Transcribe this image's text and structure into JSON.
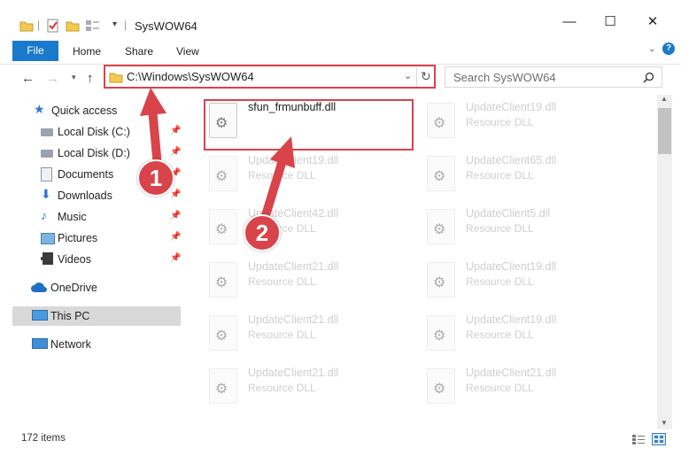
{
  "window": {
    "title": "SysWOW64",
    "minimize_glyph": "—",
    "maximize_glyph": "☐",
    "close_glyph": "✕"
  },
  "ribbon": {
    "file": "File",
    "tabs": [
      "Home",
      "Share",
      "View"
    ]
  },
  "nav": {
    "address": "C:\\Windows\\SysWOW64",
    "search_placeholder": "Search SysWOW64"
  },
  "sidebar": {
    "items": [
      {
        "label": "Quick access",
        "icon": "star-icon"
      },
      {
        "label": "Local Disk (C:)",
        "icon": "drive-icon"
      },
      {
        "label": "Local Disk (D:)",
        "icon": "drive-icon"
      },
      {
        "label": "Documents",
        "icon": "documents-icon"
      },
      {
        "label": "Downloads",
        "icon": "downloads-icon"
      },
      {
        "label": "Music",
        "icon": "music-icon"
      },
      {
        "label": "Pictures",
        "icon": "pictures-icon"
      },
      {
        "label": "Videos",
        "icon": "videos-icon"
      },
      {
        "label": "OneDrive",
        "icon": "cloud-icon"
      },
      {
        "label": "This PC",
        "icon": "computer-icon"
      },
      {
        "label": "Network",
        "icon": "network-icon"
      }
    ]
  },
  "files": [
    {
      "name": "sfun_frmunbuff.dll",
      "type": ""
    },
    {
      "name": "UpdateClient19.dll",
      "type": "Resource DLL"
    },
    {
      "name": "UpdateClient19.dll",
      "type": "Resource DLL"
    },
    {
      "name": "UpdateClient65.dll",
      "type": "Resource DLL"
    },
    {
      "name": "UpdateClient42.dll",
      "type": "Resource DLL"
    },
    {
      "name": "UpdateClient5.dll",
      "type": "Resource DLL"
    },
    {
      "name": "UpdateClient21.dll",
      "type": "Resource DLL"
    },
    {
      "name": "UpdateClient19.dll",
      "type": "Resource DLL"
    },
    {
      "name": "UpdateClient21.dll",
      "type": "Resource DLL"
    },
    {
      "name": "UpdateClient19.dll",
      "type": "Resource DLL"
    },
    {
      "name": "UpdateClient21.dll",
      "type": "Resource DLL"
    },
    {
      "name": "UpdateClient21.dll",
      "type": "Resource DLL"
    }
  ],
  "status": {
    "item_count": "172 items"
  },
  "annotations": {
    "step1": "1",
    "step2": "2",
    "accent_color": "#d9434a"
  }
}
